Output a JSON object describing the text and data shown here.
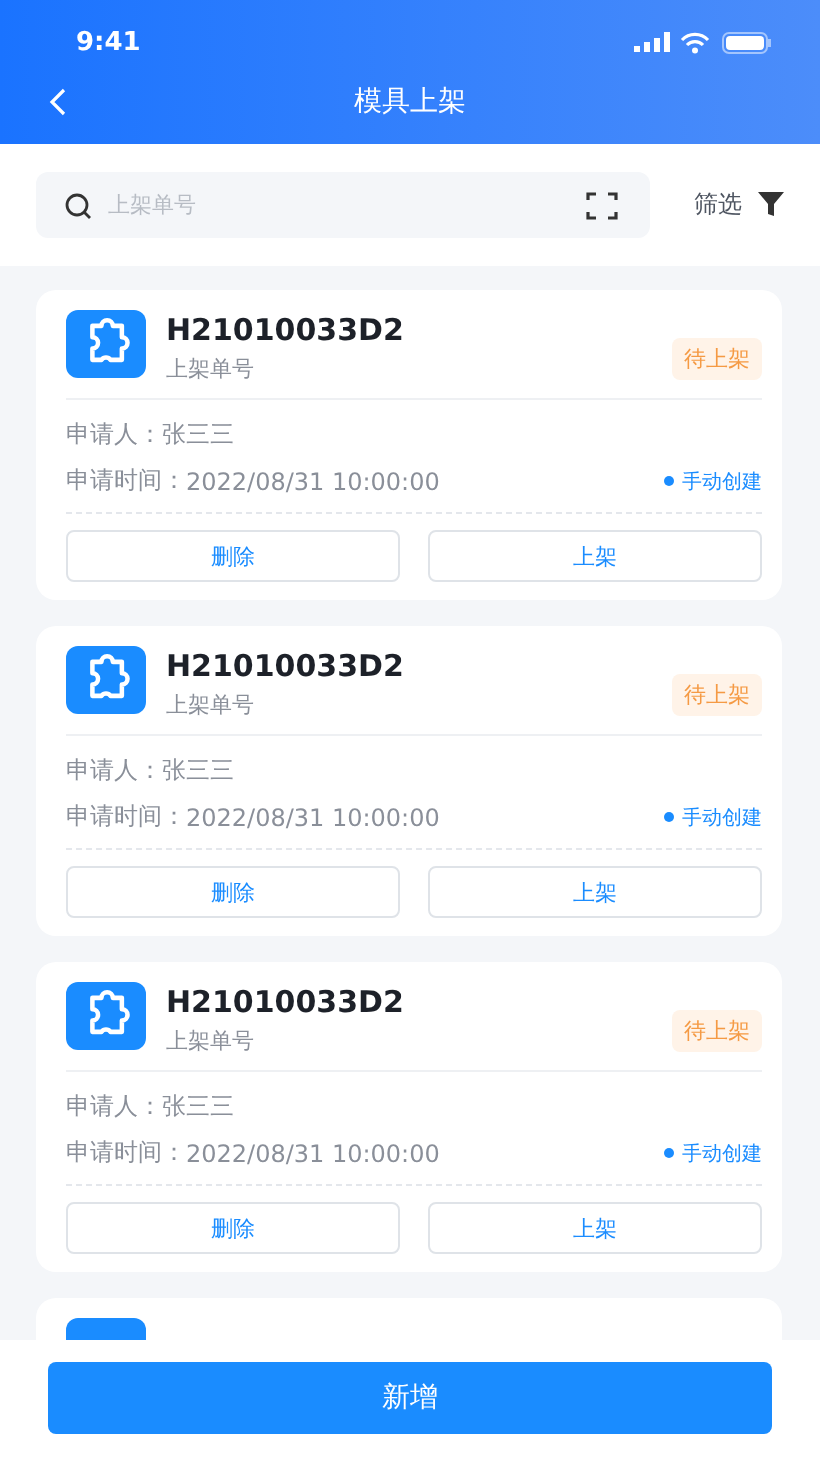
{
  "status_bar": {
    "time": "9:41"
  },
  "nav": {
    "title": "模具上架"
  },
  "search": {
    "placeholder": "上架单号",
    "filter_label": "筛选"
  },
  "orders": [
    {
      "number": "H21010033D2",
      "subtitle": "上架单号",
      "status": "待上架",
      "applicant_label": "申请人：",
      "applicant": "张三三",
      "time_label": "申请时间：",
      "time": "2022/08/31 10:00:00",
      "source": "手动创建",
      "actions": [
        "删除",
        "上架"
      ]
    },
    {
      "number": "H21010033D2",
      "subtitle": "上架单号",
      "status": "待上架",
      "applicant_label": "申请人：",
      "applicant": "张三三",
      "time_label": "申请时间：",
      "time": "2022/08/31 10:00:00",
      "source": "手动创建",
      "actions": [
        "删除",
        "上架"
      ]
    },
    {
      "number": "H21010033D2",
      "subtitle": "上架单号",
      "status": "待上架",
      "applicant_label": "申请人：",
      "applicant": "张三三",
      "time_label": "申请时间：",
      "time": "2022/08/31 10:00:00",
      "source": "手动创建",
      "actions": [
        "删除",
        "上架"
      ]
    }
  ],
  "primary_button": "新增"
}
